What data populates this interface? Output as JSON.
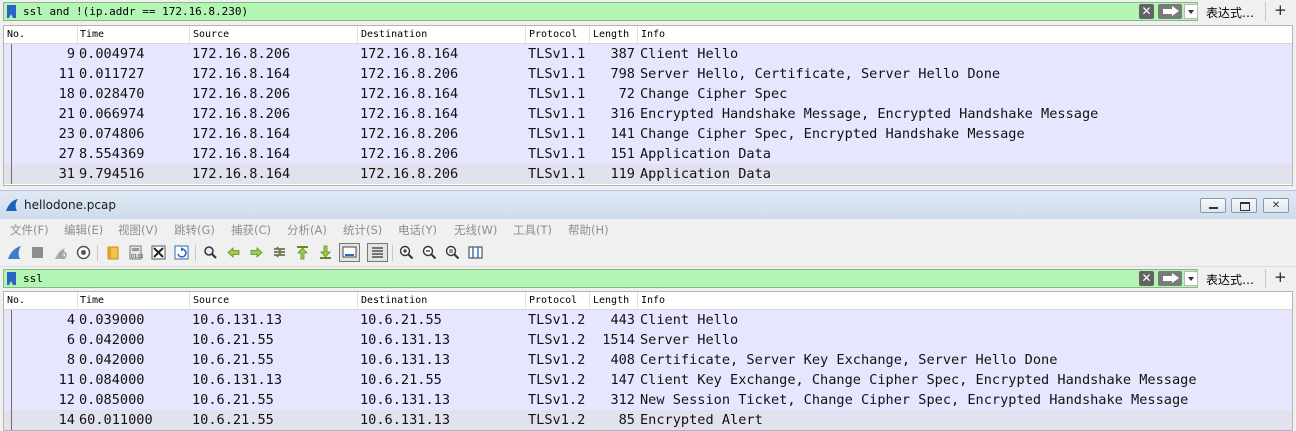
{
  "top_pane": {
    "filter": {
      "value": "ssl and !(ip.addr == 172.16.8.230)",
      "clear_symbol": "✕",
      "expression_label": "表达式…",
      "plus_label": "+"
    },
    "columns": [
      "No.",
      "Time",
      "Source",
      "Destination",
      "Protocol",
      "Length",
      "Info"
    ],
    "rows": [
      {
        "no": "9",
        "time": "0.004974",
        "source": "172.16.8.206",
        "destination": "172.16.8.164",
        "protocol": "TLSv1.1",
        "length": "387",
        "info": "Client Hello"
      },
      {
        "no": "11",
        "time": "0.011727",
        "source": "172.16.8.164",
        "destination": "172.16.8.206",
        "protocol": "TLSv1.1",
        "length": "798",
        "info": "Server Hello, Certificate, Server Hello Done"
      },
      {
        "no": "18",
        "time": "0.028470",
        "source": "172.16.8.206",
        "destination": "172.16.8.164",
        "protocol": "TLSv1.1",
        "length": "72",
        "info": "Change Cipher Spec"
      },
      {
        "no": "21",
        "time": "0.066974",
        "source": "172.16.8.206",
        "destination": "172.16.8.164",
        "protocol": "TLSv1.1",
        "length": "316",
        "info": "Encrypted Handshake Message, Encrypted Handshake Message"
      },
      {
        "no": "23",
        "time": "0.074806",
        "source": "172.16.8.164",
        "destination": "172.16.8.206",
        "protocol": "TLSv1.1",
        "length": "141",
        "info": "Change Cipher Spec, Encrypted Handshake Message"
      },
      {
        "no": "27",
        "time": "8.554369",
        "source": "172.16.8.164",
        "destination": "172.16.8.206",
        "protocol": "TLSv1.1",
        "length": "151",
        "info": "Application Data"
      },
      {
        "no": "31",
        "time": "9.794516",
        "source": "172.16.8.164",
        "destination": "172.16.8.206",
        "protocol": "TLSv1.1",
        "length": "119",
        "info": "Application Data"
      }
    ]
  },
  "window": {
    "title": "hellodone.pcap",
    "close_symbol": "✕",
    "menu": [
      "文件(F)",
      "编辑(E)",
      "视图(V)",
      "跳转(G)",
      "捕获(C)",
      "分析(A)",
      "统计(S)",
      "电话(Y)",
      "无线(W)",
      "工具(T)",
      "帮助(H)"
    ],
    "toolbar_icons": [
      "shark-fin-start-icon",
      "stop-capture-icon",
      "restart-capture-icon",
      "capture-options-icon",
      "open-file-icon",
      "save-file-icon",
      "close-file-icon",
      "reload-file-icon",
      "find-packet-icon",
      "go-back-icon",
      "go-forward-icon",
      "go-to-packet-icon",
      "go-first-icon",
      "go-last-icon",
      "auto-scroll-icon",
      "colorize-icon",
      "zoom-in-icon",
      "zoom-out-icon",
      "normal-size-icon",
      "resize-columns-icon"
    ]
  },
  "bottom_pane": {
    "filter": {
      "value": "ssl",
      "clear_symbol": "✕",
      "expression_label": "表达式…",
      "plus_label": "+"
    },
    "columns": [
      "No.",
      "Time",
      "Source",
      "Destination",
      "Protocol",
      "Length",
      "Info"
    ],
    "rows": [
      {
        "no": "4",
        "time": "0.039000",
        "source": "10.6.131.13",
        "destination": "10.6.21.55",
        "protocol": "TLSv1.2",
        "length": "443",
        "info": "Client Hello"
      },
      {
        "no": "6",
        "time": "0.042000",
        "source": "10.6.21.55",
        "destination": "10.6.131.13",
        "protocol": "TLSv1.2",
        "length": "1514",
        "info": "Server Hello"
      },
      {
        "no": "8",
        "time": "0.042000",
        "source": "10.6.21.55",
        "destination": "10.6.131.13",
        "protocol": "TLSv1.2",
        "length": "408",
        "info": "Certificate, Server Key Exchange, Server Hello Done"
      },
      {
        "no": "11",
        "time": "0.084000",
        "source": "10.6.131.13",
        "destination": "10.6.21.55",
        "protocol": "TLSv1.2",
        "length": "147",
        "info": "Client Key Exchange, Change Cipher Spec, Encrypted Handshake Message"
      },
      {
        "no": "12",
        "time": "0.085000",
        "source": "10.6.21.55",
        "destination": "10.6.131.13",
        "protocol": "TLSv1.2",
        "length": "312",
        "info": "New Session Ticket, Change Cipher Spec, Encrypted Handshake Message"
      },
      {
        "no": "14",
        "time": "60.011000",
        "source": "10.6.21.55",
        "destination": "10.6.131.13",
        "protocol": "TLSv1.2",
        "length": "85",
        "info": "Encrypted Alert"
      }
    ]
  },
  "colors": {
    "filter_valid_bg": "#b3f6b3",
    "row_bg": "#e7e6ff",
    "selected_row_bg": "#e2e2ef",
    "bookmark_blue": "#2a64c6"
  }
}
